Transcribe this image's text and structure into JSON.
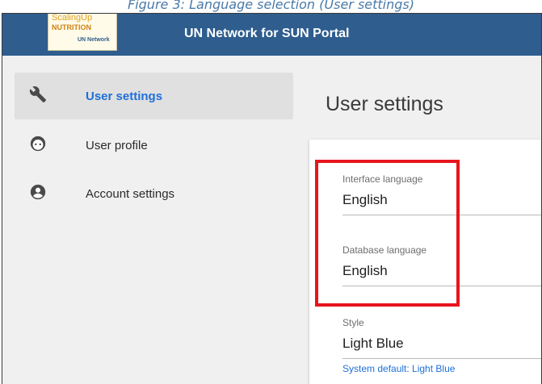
{
  "caption": "Figure 3: Language selection (User settings)",
  "app": {
    "title": "UN Network for SUN Portal",
    "logo": {
      "line1": "ScalingUp",
      "line2": "NUTRITION",
      "line3": "UN Network"
    }
  },
  "sidebar": {
    "items": [
      {
        "label": "User settings",
        "icon": "wrench-icon",
        "active": true
      },
      {
        "label": "User profile",
        "icon": "face-icon",
        "active": false
      },
      {
        "label": "Account settings",
        "icon": "account-circle-icon",
        "active": false
      }
    ]
  },
  "main": {
    "title": "User settings",
    "fields": [
      {
        "label": "Interface language",
        "value": "English"
      },
      {
        "label": "Database language",
        "value": "English"
      },
      {
        "label": "Style",
        "value": "Light Blue",
        "hint": "System default: Light Blue"
      }
    ]
  },
  "colors": {
    "appbar": "#2e5d8e",
    "active_text": "#1e6fd9",
    "highlight": "#e8141c"
  }
}
